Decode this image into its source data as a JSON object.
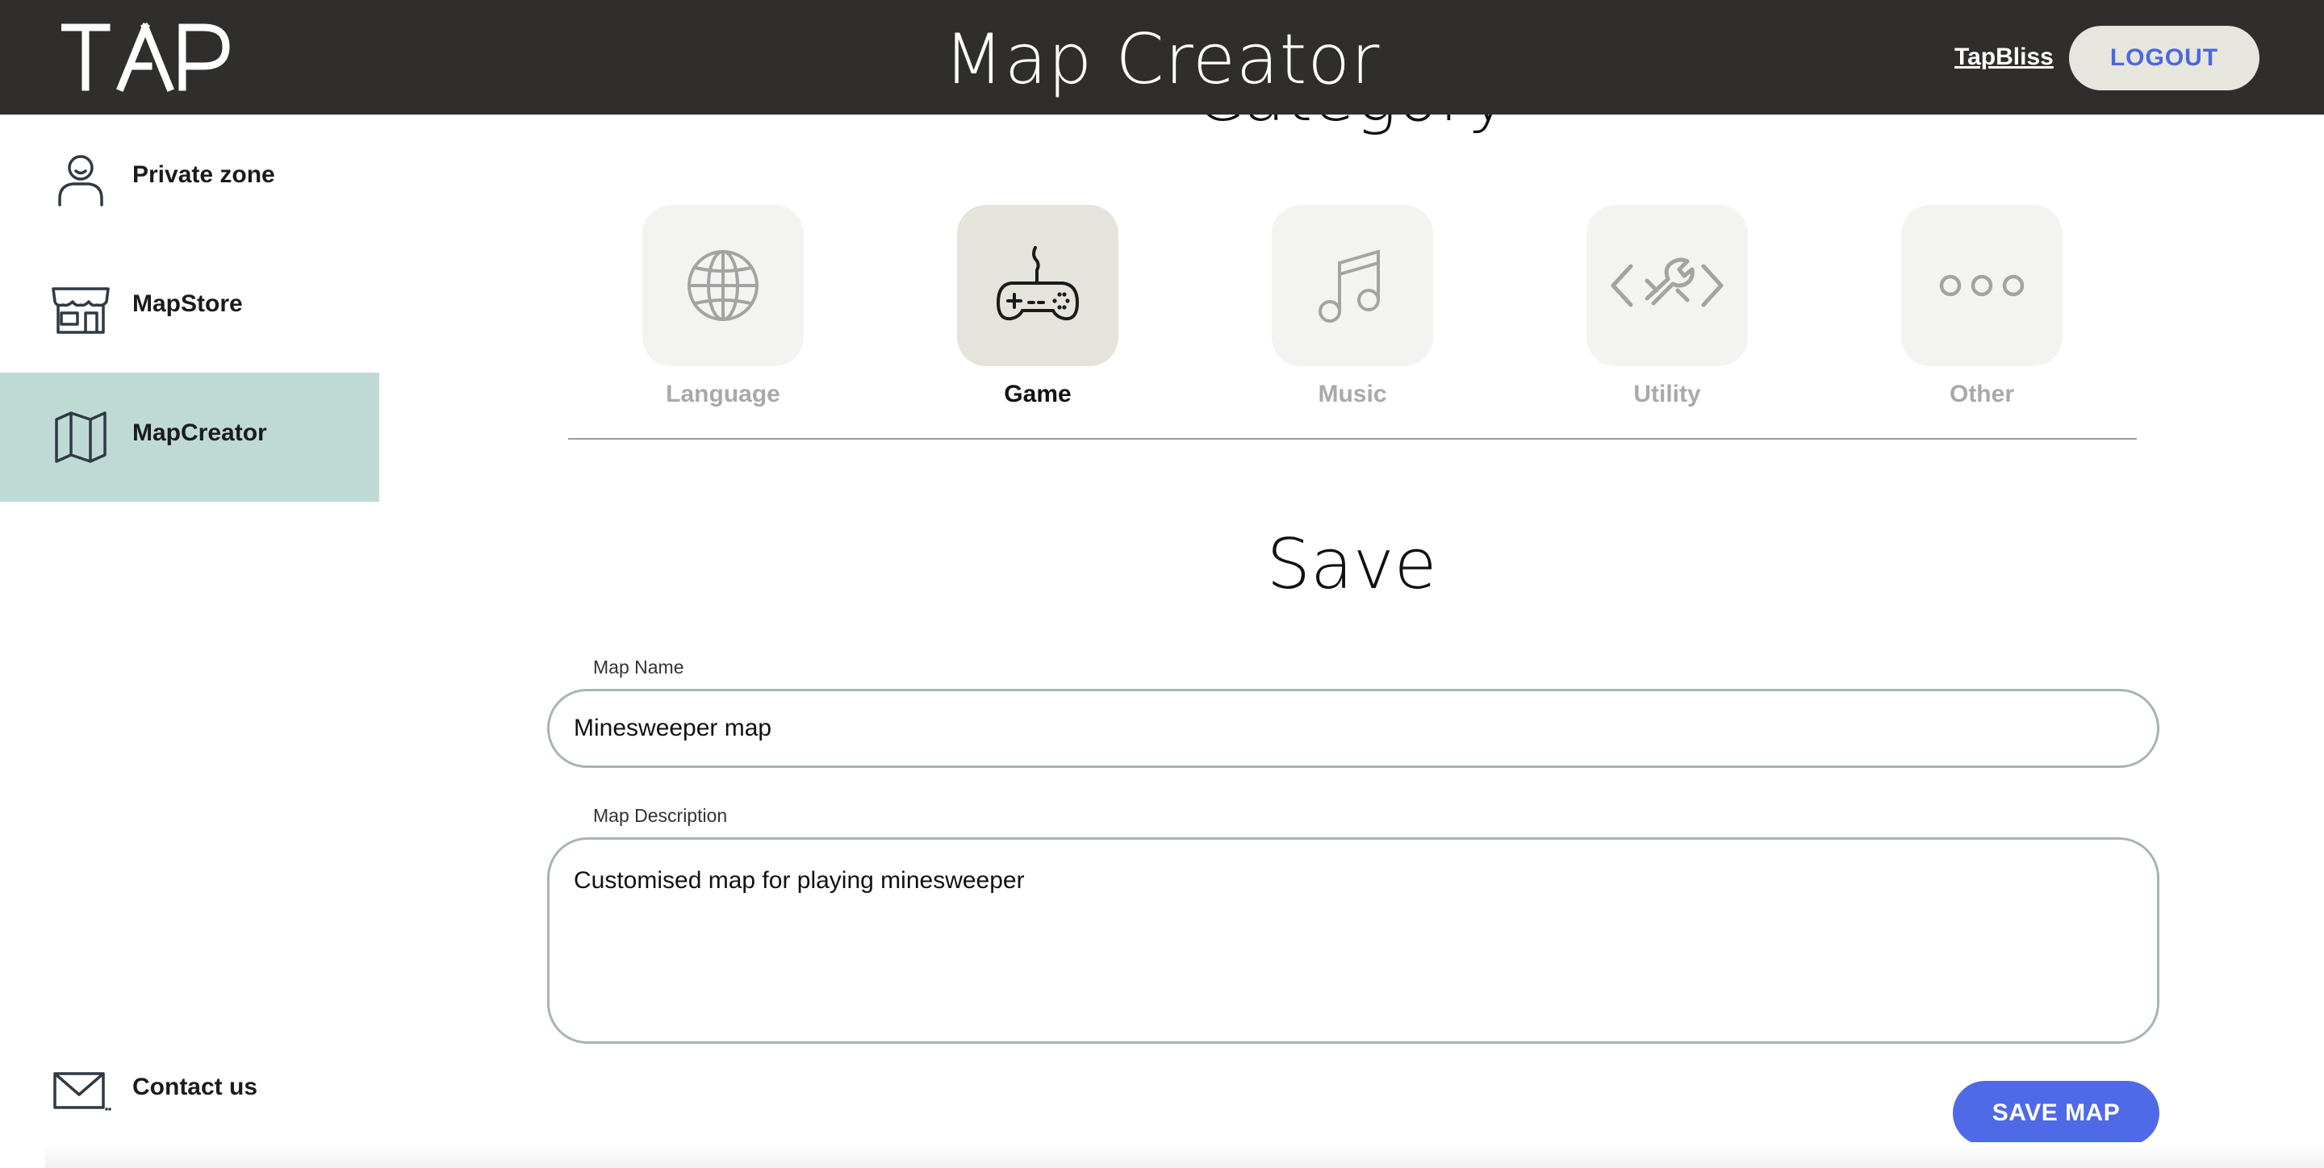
{
  "header": {
    "logo_text": "TAP",
    "title": "Map Creator",
    "username": "TapBliss",
    "logout_label": "LOGOUT"
  },
  "sidebar": {
    "items": [
      {
        "label": "Private zone",
        "icon": "person-icon",
        "active": false
      },
      {
        "label": "MapStore",
        "icon": "store-icon",
        "active": false
      },
      {
        "label": "MapCreator",
        "icon": "map-icon",
        "active": true
      }
    ],
    "contact_label": "Contact us",
    "contact_icon": "mail-icon"
  },
  "category": {
    "title": "Category",
    "options": [
      {
        "label": "Language",
        "icon": "globe-icon",
        "selected": false
      },
      {
        "label": "Game",
        "icon": "gamepad-icon",
        "selected": true
      },
      {
        "label": "Music",
        "icon": "music-note-icon",
        "selected": false
      },
      {
        "label": "Utility",
        "icon": "code-wrench-icon",
        "selected": false
      },
      {
        "label": "Other",
        "icon": "more-dots-icon",
        "selected": false
      }
    ]
  },
  "save": {
    "title": "Save",
    "map_name_label": "Map Name",
    "map_name_value": "Minesweeper map",
    "map_description_label": "Map Description",
    "map_description_value": "Customised map for playing minesweeper",
    "save_button_label": "SAVE MAP"
  },
  "colors": {
    "header_bg": "#2f2e2c",
    "sidebar_active": "#bfdad5",
    "accent_blue": "#4f6ae6",
    "logout_bg": "#e6e6df"
  }
}
